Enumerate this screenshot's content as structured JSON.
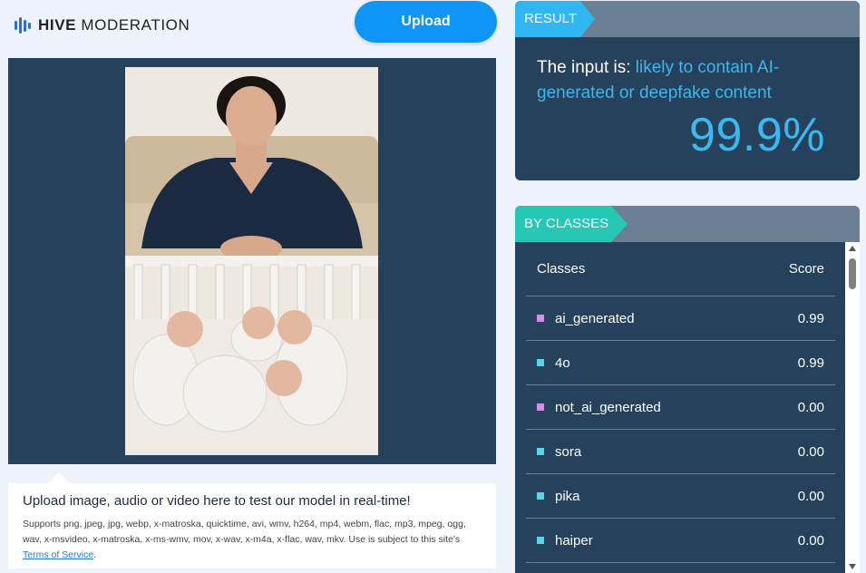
{
  "header": {
    "brand_bold": "HIVE",
    "brand_rest": " MODERATION",
    "upload_label": "Upload"
  },
  "upload_info": {
    "title": "Upload image, audio or video here to test our model in real-time!",
    "supports_text": "Supports png, jpeg, jpg, webp, x-matroska, quicktime, avi, wmv, h264, mp4, webm, flac, mp3, mpeg, ogg, wav, x-msvideo, x-matroska, x-ms-wmv, mov, x-wav, x-m4a, x-flac, wav, mkv. Use is subject to this site's ",
    "tos_link": "Terms of Service",
    "tos_suffix": "."
  },
  "result": {
    "tag": "RESULT",
    "prefix": "The input is: ",
    "verdict": "likely to contain AI-generated or deepfake content",
    "percent": "99.9%"
  },
  "classes": {
    "tag": "BY CLASSES",
    "col_class": "Classes",
    "col_score": "Score",
    "rows": [
      {
        "name": "ai_generated",
        "score": "0.99",
        "color": "#d58ee8"
      },
      {
        "name": "4o",
        "score": "0.99",
        "color": "#57d6ea"
      },
      {
        "name": "not_ai_generated",
        "score": "0.00",
        "color": "#d58ee8"
      },
      {
        "name": "sora",
        "score": "0.00",
        "color": "#57d6ea"
      },
      {
        "name": "pika",
        "score": "0.00",
        "color": "#57d6ea"
      },
      {
        "name": "haiper",
        "score": "0.00",
        "color": "#57d6ea"
      }
    ]
  },
  "colors": {
    "accent": "#0f95f5",
    "panel": "#25415c",
    "highlight": "#3ab8f0",
    "classes_tag": "#26c8b4"
  }
}
